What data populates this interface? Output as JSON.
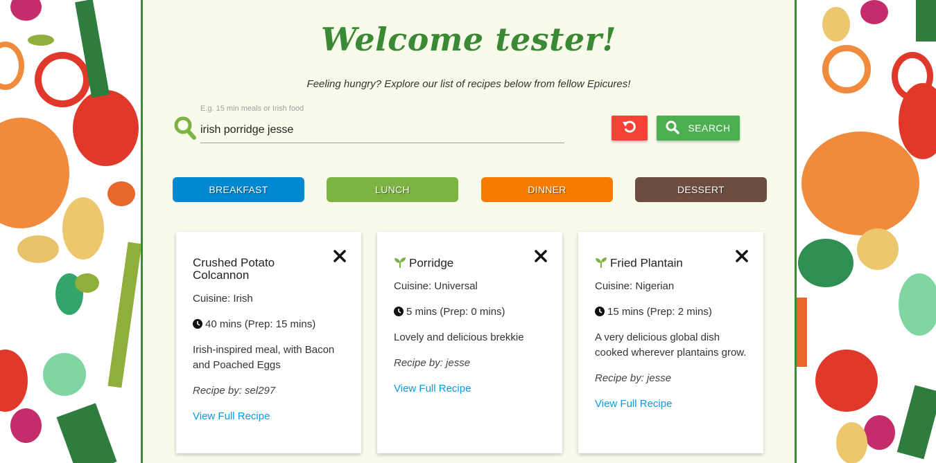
{
  "header": {
    "title": "Welcome tester!",
    "subtitle": "Feeling hungry? Explore our list of recipes below from fellow Epicures!"
  },
  "search": {
    "hint": "E.g. 15 min meals or Irish food",
    "value": "irish porridge jesse",
    "search_label": "SEARCH"
  },
  "categories": [
    {
      "label": "BREAKFAST",
      "color": "#0288d1"
    },
    {
      "label": "LUNCH",
      "color": "#7cb342"
    },
    {
      "label": "DINNER",
      "color": "#f57c00"
    },
    {
      "label": "DESSERT",
      "color": "#6d4c41"
    }
  ],
  "recipes": [
    {
      "title": "Crushed Potato Colcannon",
      "cuisine": "Cuisine: Irish",
      "time": "40 mins (Prep: 15 mins)",
      "description": "Irish-inspired meal, with Bacon and Poached Eggs",
      "author": "Recipe by: sel297",
      "link": "View Full Recipe",
      "vegetarian": false
    },
    {
      "title": "Porridge",
      "cuisine": "Cuisine: Universal",
      "time": "5 mins (Prep: 0 mins)",
      "description": "Lovely and delicious brekkie",
      "author": "Recipe by: jesse",
      "link": "View Full Recipe",
      "vegetarian": true
    },
    {
      "title": "Fried Plantain",
      "cuisine": "Cuisine: Nigerian",
      "time": "15 mins (Prep: 2 mins)",
      "description": "A very delicious global dish cooked wherever plantains grow.",
      "author": "Recipe by: jesse",
      "link": "View Full Recipe",
      "vegetarian": true
    }
  ],
  "colors": {
    "accent": "#3a8a35",
    "reset": "#f44336",
    "search": "#4caf50",
    "link": "#039be5"
  },
  "icons": {
    "search": "search-icon",
    "reset": "undo-icon",
    "close": "close-icon",
    "clock": "clock-icon",
    "vegetarian": "sprout-icon"
  }
}
